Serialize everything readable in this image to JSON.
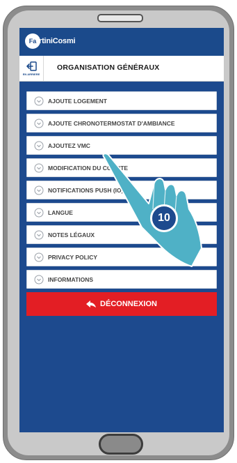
{
  "app": {
    "brand_prefix": "Fa",
    "brand_name": "rtiniCosmi",
    "page_title": "ORGANISATION GÉNÉRAUX",
    "back_label": "EN ARRIERE"
  },
  "menu": {
    "items": [
      {
        "label": "AJOUTE LOGEMENT"
      },
      {
        "label": "AJOUTE CHRONOTERMOSTAT D'AMBIANCE"
      },
      {
        "label": "AJOUTEZ VMC"
      },
      {
        "label": "MODIFICATION DU COMPTE"
      },
      {
        "label": "NOTIFICATIONS PUSH (IO)"
      },
      {
        "label": "LANGUE"
      },
      {
        "label": "NOTES LÉGAUX"
      },
      {
        "label": "PRIVACY POLICY"
      },
      {
        "label": "INFORMATIONS"
      }
    ],
    "logout_label": "DÉCONNEXION"
  },
  "annotation": {
    "step_number": "10"
  },
  "colors": {
    "brand_blue": "#1d4a8e",
    "logout_red": "#e31e24",
    "hand_teal": "#4fb1c6"
  }
}
